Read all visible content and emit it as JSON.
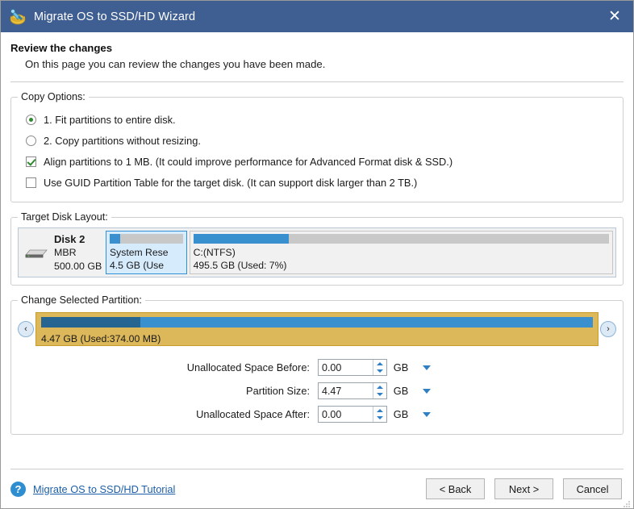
{
  "window": {
    "title": "Migrate OS to SSD/HD Wizard",
    "app_icon": "migrate-disk-icon",
    "close_label": "✕",
    "titlebar_color": "#3f5e92"
  },
  "header": {
    "heading": "Review the changes",
    "subheading": "On this page you can review the changes you have been made."
  },
  "copy_options": {
    "legend": "Copy Options:",
    "items": [
      {
        "type": "radio",
        "label": "1. Fit partitions to entire disk.",
        "checked": true
      },
      {
        "type": "radio",
        "label": "2. Copy partitions without resizing.",
        "checked": false
      },
      {
        "type": "checkbox",
        "label": "Align partitions to 1 MB.  (It could improve performance for Advanced Format disk & SSD.)",
        "checked": true
      },
      {
        "type": "checkbox",
        "label": "Use GUID Partition Table for the target disk. (It can support disk larger than 2 TB.)",
        "checked": false
      }
    ]
  },
  "target_disk": {
    "legend": "Target Disk Layout:",
    "disk_name": "Disk 2",
    "scheme": "MBR",
    "capacity": "500.00 GB",
    "drive_icon": "hard-drive-icon",
    "partitions": [
      {
        "name": "System Rese",
        "detail": "4.5 GB (Use",
        "used_percent": 14,
        "width_percent": 16,
        "selected": true
      },
      {
        "name": "C:(NTFS)",
        "detail": "495.5 GB (Used: 7%)",
        "used_percent": 23,
        "width_percent": 84,
        "selected": false
      }
    ]
  },
  "change_partition": {
    "legend": "Change Selected Partition:",
    "left_arrow": "‹",
    "right_arrow": "›",
    "bar_used_percent": 18,
    "caption": "4.47 GB (Used:374.00 MB)",
    "fields": [
      {
        "label": "Unallocated Space Before:",
        "value": "0.00",
        "unit": "GB"
      },
      {
        "label": "Partition Size:",
        "value": "4.47",
        "unit": "GB"
      },
      {
        "label": "Unallocated Space After:",
        "value": "0.00",
        "unit": "GB"
      }
    ]
  },
  "footer": {
    "help_icon": "?",
    "tutorial_link": "Migrate OS to SSD/HD Tutorial",
    "buttons": [
      {
        "label": "< Back"
      },
      {
        "label": "Next >"
      },
      {
        "label": "Cancel"
      }
    ]
  }
}
